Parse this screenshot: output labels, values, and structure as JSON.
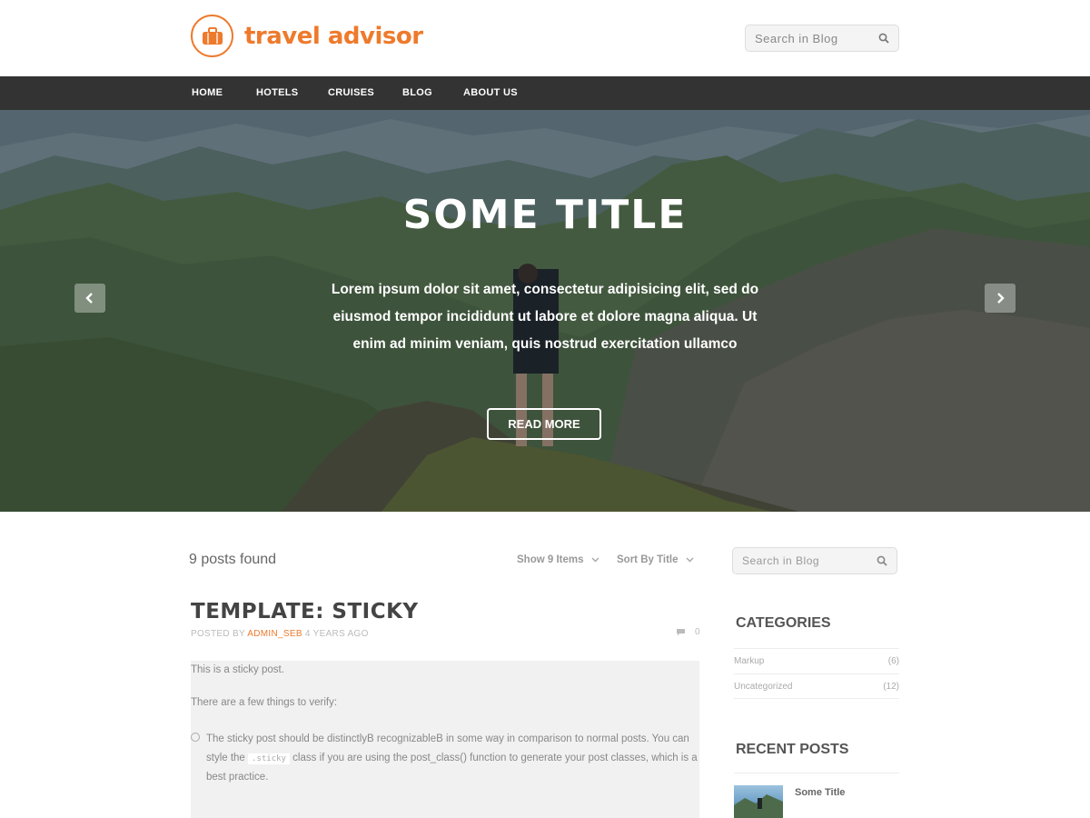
{
  "header": {
    "brand": "travel advisor",
    "search_placeholder": "Search in Blog"
  },
  "nav": {
    "items": [
      {
        "label": "HOME"
      },
      {
        "label": "HOTELS"
      },
      {
        "label": "CRUISES"
      },
      {
        "label": "BLOG"
      },
      {
        "label": "ABOUT US"
      }
    ]
  },
  "hero": {
    "title": "SOME TITLE",
    "line1": "Lorem ipsum dolor sit amet, consectetur adipisicing elit, sed do",
    "line2": "eiusmod tempor incididunt ut labore et dolore magna aliqua. Ut",
    "line3": "enim ad minim veniam, quis nostrud exercitation ullamco",
    "button": "READ MORE"
  },
  "listing": {
    "count_text": "9 posts found",
    "show_label": "Show 9 Items",
    "sort_label": "Sort By Title"
  },
  "post": {
    "title": "TEMPLATE: STICKY",
    "meta_prefix": "POSTED BY",
    "author": "ADMIN_SEB",
    "age": "4 YEARS AGO",
    "comment_count": "0",
    "para1": "This is a sticky post.",
    "para2": "There are a few things to verify:",
    "bullet_part1": "The sticky post should be distinctlyB recognizableB in some way in comparison to normal posts. You can style the",
    "bullet_code": ".sticky",
    "bullet_part2": "class if you are using the post_class() function to generate your post classes, which is a best practice."
  },
  "sidebar": {
    "search_placeholder": "Search in Blog",
    "categories_heading": "CATEGORIES",
    "categories": [
      {
        "name": "Markup",
        "count": "(6)"
      },
      {
        "name": "Uncategorized",
        "count": "(12)"
      }
    ],
    "recent_heading": "RECENT POSTS",
    "recent": [
      {
        "title": "Some Title"
      }
    ]
  },
  "colors": {
    "accent": "#ee7a2c",
    "nav_bg": "#333333",
    "post_body_bg": "#f1f1f1"
  },
  "icons": [
    "suitcase-icon",
    "search-icon",
    "chevron-left-icon",
    "chevron-right-icon",
    "chevron-down-icon",
    "comment-icon",
    "circle-bullet-icon"
  ]
}
